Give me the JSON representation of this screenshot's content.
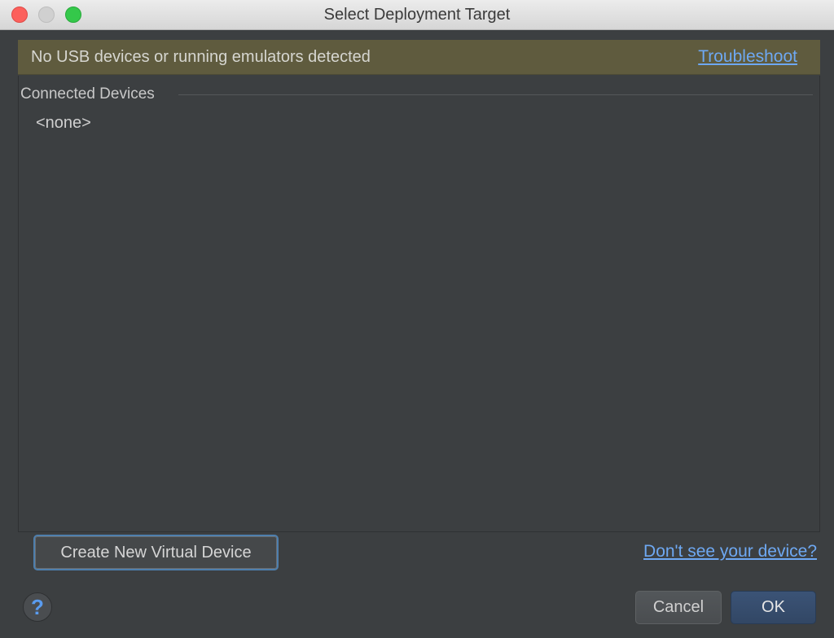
{
  "window": {
    "title": "Select Deployment Target"
  },
  "banner": {
    "message": "No USB devices or running emulators detected",
    "link_label": "Troubleshoot",
    "background_color": "#5f5b3e"
  },
  "devices": {
    "section_title": "Connected Devices",
    "items": [
      "<none>"
    ]
  },
  "actions": {
    "create_label": "Create New Virtual Device",
    "dont_see_label": "Don't see your device?",
    "help_label": "?",
    "cancel_label": "Cancel",
    "ok_label": "OK"
  },
  "colors": {
    "link": "#6ea8f2",
    "ok_button": "#3b5376",
    "panel_background": "#3c3f41"
  }
}
